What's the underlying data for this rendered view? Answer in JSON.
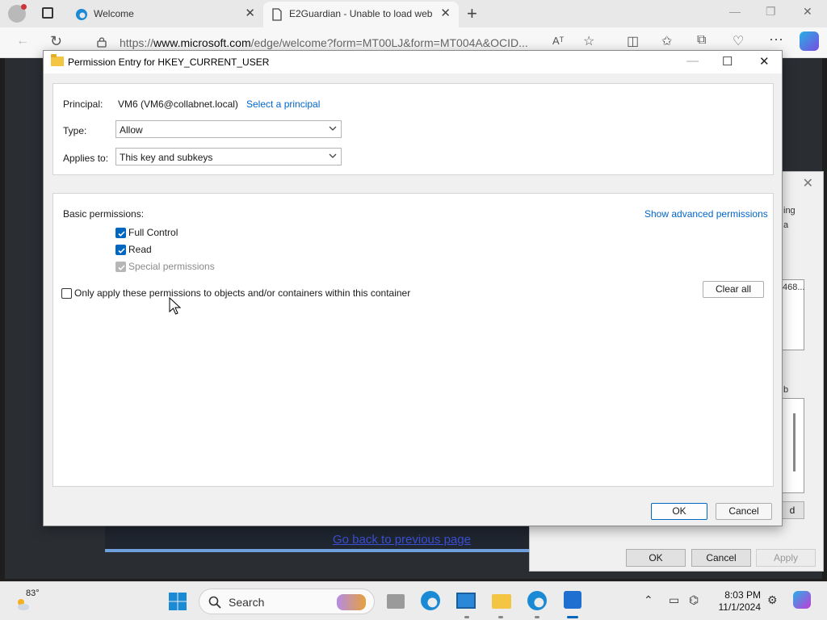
{
  "browser": {
    "tabs": [
      {
        "title": "Welcome",
        "active": false
      },
      {
        "title": "E2Guardian - Unable to load web",
        "active": true
      }
    ],
    "new_tab": "+",
    "address": {
      "prefix": "https://",
      "domain": "www.microsoft.com",
      "path": "/edge/welcome?form=MT00LJ&form=MT004A&OCID..."
    },
    "read_aloud": "Aᵀ",
    "window": {
      "minimize": "—",
      "restore": "❐",
      "close": "✕"
    }
  },
  "page": {
    "back_link": "Go back to previous page"
  },
  "background_dialog": {
    "fragments": [
      "ing",
      "a",
      "468...",
      "d",
      "b"
    ],
    "buttons": {
      "ok": "OK",
      "cancel": "Cancel",
      "apply": "Apply"
    }
  },
  "dialog": {
    "title": "Permission Entry for HKEY_CURRENT_USER",
    "principal_label": "Principal:",
    "principal_value": "VM6 (VM6@collabnet.local)",
    "select_principal": "Select a principal",
    "type_label": "Type:",
    "type_value": "Allow",
    "applies_label": "Applies to:",
    "applies_value": "This key and subkeys",
    "basic_label": "Basic permissions:",
    "show_advanced": "Show advanced permissions",
    "permissions": [
      {
        "label": "Full Control",
        "checked": true,
        "enabled": true
      },
      {
        "label": "Read",
        "checked": true,
        "enabled": true
      },
      {
        "label": "Special permissions",
        "checked": true,
        "enabled": false
      }
    ],
    "only_apply": "Only apply these permissions to objects and/or containers within this container",
    "only_apply_checked": false,
    "clear_all": "Clear all",
    "ok": "OK",
    "cancel": "Cancel"
  },
  "taskbar": {
    "weather": "83°",
    "search": "Search",
    "time": "8:03 PM",
    "date": "11/1/2024"
  },
  "colors": {
    "accent": "#0067c0",
    "link": "#0066cc"
  }
}
